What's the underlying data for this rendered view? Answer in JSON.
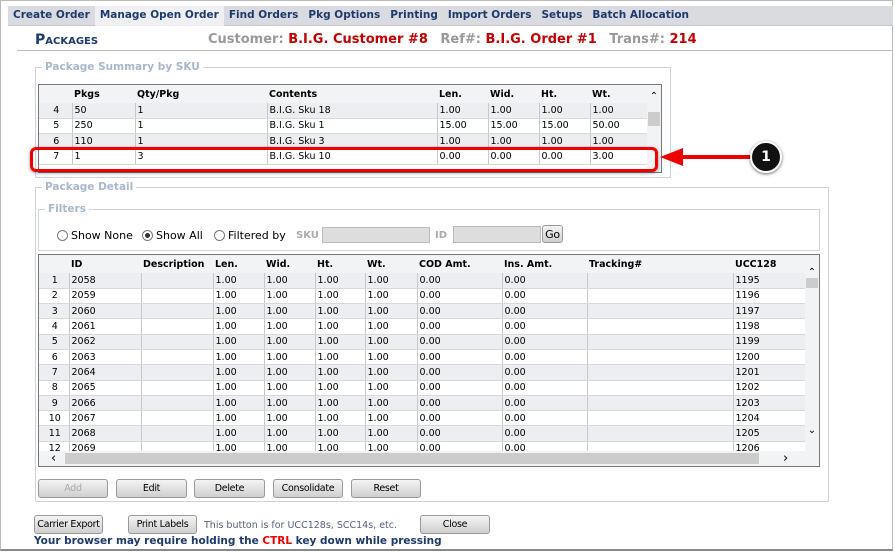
{
  "nav": [
    "Create Order",
    "Manage Open Order",
    "Find Orders",
    "Pkg Options",
    "Printing",
    "Import Orders",
    "Setups",
    "Batch Allocation"
  ],
  "active_tab": "Manage Open Order",
  "title": "Packages",
  "header": {
    "customer_label": "Customer:",
    "customer": "B.I.G. Customer #8",
    "ref_label": "Ref#:",
    "ref": "B.I.G. Order #1",
    "trans_label": "Trans#:",
    "trans": "214"
  },
  "summary": {
    "legend": "Package Summary by SKU",
    "columns": [
      "",
      "Pkgs",
      "Qty/Pkg",
      "Contents",
      "Len.",
      "Wid.",
      "Ht.",
      "Wt."
    ],
    "rows": [
      [
        "4",
        "50",
        "1",
        "B.I.G. Sku 18",
        "1.00",
        "1.00",
        "1.00",
        "1.00"
      ],
      [
        "5",
        "250",
        "1",
        "B.I.G. Sku 1",
        "15.00",
        "15.00",
        "15.00",
        "50.00"
      ],
      [
        "6",
        "110",
        "1",
        "B.I.G. Sku 3",
        "1.00",
        "1.00",
        "1.00",
        "1.00"
      ],
      [
        "7",
        "1",
        "3",
        "B.I.G. Sku 10",
        "0.00",
        "0.00",
        "0.00",
        "3.00"
      ]
    ]
  },
  "callout": "1",
  "highlight_color": "#e00000",
  "detail": {
    "legend": "Package Detail",
    "filters_legend": "Filters",
    "radios": [
      {
        "label": "Show None",
        "checked": false
      },
      {
        "label": "Show All",
        "checked": true
      },
      {
        "label": "Filtered by",
        "checked": false
      }
    ],
    "sku_label": "SKU",
    "id_label": "ID",
    "go": "Go",
    "columns": [
      "",
      "ID",
      "Description",
      "Len.",
      "Wid.",
      "Ht.",
      "Wt.",
      "COD Amt.",
      "Ins. Amt.",
      "Tracking#",
      "UCC128"
    ],
    "rows": [
      [
        "1",
        "2058",
        "",
        "1.00",
        "1.00",
        "1.00",
        "1.00",
        "0.00",
        "0.00",
        "",
        "1195"
      ],
      [
        "2",
        "2059",
        "",
        "1.00",
        "1.00",
        "1.00",
        "1.00",
        "0.00",
        "0.00",
        "",
        "1196"
      ],
      [
        "3",
        "2060",
        "",
        "1.00",
        "1.00",
        "1.00",
        "1.00",
        "0.00",
        "0.00",
        "",
        "1197"
      ],
      [
        "4",
        "2061",
        "",
        "1.00",
        "1.00",
        "1.00",
        "1.00",
        "0.00",
        "0.00",
        "",
        "1198"
      ],
      [
        "5",
        "2062",
        "",
        "1.00",
        "1.00",
        "1.00",
        "1.00",
        "0.00",
        "0.00",
        "",
        "1199"
      ],
      [
        "6",
        "2063",
        "",
        "1.00",
        "1.00",
        "1.00",
        "1.00",
        "0.00",
        "0.00",
        "",
        "1200"
      ],
      [
        "7",
        "2064",
        "",
        "1.00",
        "1.00",
        "1.00",
        "1.00",
        "0.00",
        "0.00",
        "",
        "1201"
      ],
      [
        "8",
        "2065",
        "",
        "1.00",
        "1.00",
        "1.00",
        "1.00",
        "0.00",
        "0.00",
        "",
        "1202"
      ],
      [
        "9",
        "2066",
        "",
        "1.00",
        "1.00",
        "1.00",
        "1.00",
        "0.00",
        "0.00",
        "",
        "1203"
      ],
      [
        "10",
        "2067",
        "",
        "1.00",
        "1.00",
        "1.00",
        "1.00",
        "0.00",
        "0.00",
        "",
        "1204"
      ],
      [
        "11",
        "2068",
        "",
        "1.00",
        "1.00",
        "1.00",
        "1.00",
        "0.00",
        "0.00",
        "",
        "1205"
      ],
      [
        "12",
        "2069",
        "",
        "1.00",
        "1.00",
        "1.00",
        "1.00",
        "0.00",
        "0.00",
        "",
        "1206"
      ]
    ],
    "buttons": [
      "Add",
      "Edit",
      "Delete",
      "Consolidate",
      "Reset"
    ]
  },
  "footer": {
    "carrier_export": "Carrier Export",
    "print_labels": "Print Labels",
    "print_note": "This button is for UCC128s, SCC14s, etc.",
    "close": "Close",
    "browser_note_a": "Your browser may require holding the ",
    "ctrl": "CTRL",
    "browser_note_b": " key down while pressing"
  }
}
